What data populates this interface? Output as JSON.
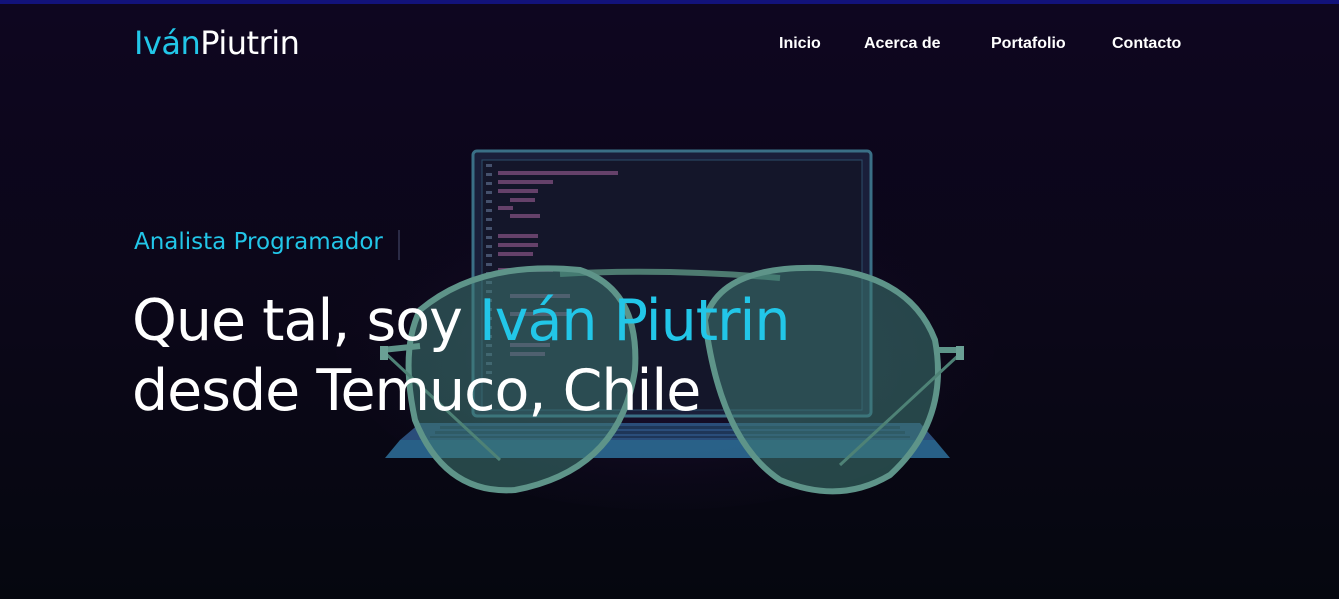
{
  "header": {
    "logo_first": "Iván",
    "logo_last": "Piutrin"
  },
  "nav": {
    "items": [
      {
        "label": "Inicio"
      },
      {
        "label": "Acerca de"
      },
      {
        "label": "Portafolio"
      },
      {
        "label": "Contacto"
      }
    ]
  },
  "hero": {
    "subtitle": "Analista Programador",
    "headline_prefix": "Que tal, soy ",
    "headline_name": "Iván Piutrin",
    "headline_line2": "desde Temuco, Chile"
  },
  "colors": {
    "accent": "#22c6e8",
    "background": "#0b0718",
    "text": "#ffffff"
  }
}
